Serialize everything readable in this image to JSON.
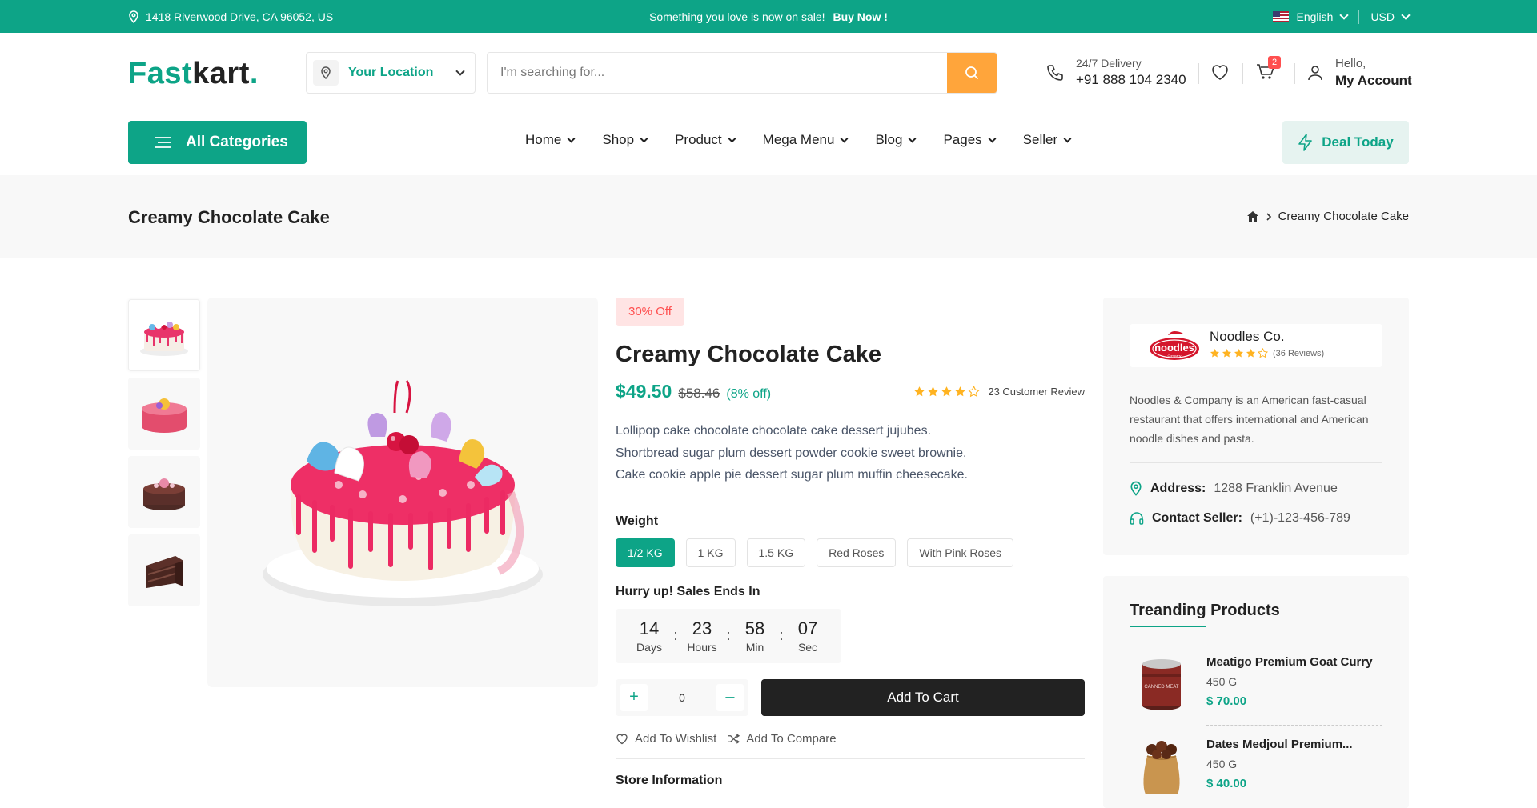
{
  "topbar": {
    "address": "1418 Riverwood Drive, CA 96052, US",
    "promo_text": "Something you love is now on sale!",
    "promo_link": "Buy Now !",
    "language": "English",
    "currency": "USD"
  },
  "header": {
    "logo_part1": "Fast",
    "logo_part2": "kart",
    "logo_dot": ".",
    "location_label": "Your Location",
    "search_placeholder": "I'm searching for...",
    "delivery_label": "24/7 Delivery",
    "delivery_phone": "+91 888 104 2340",
    "cart_count": "2",
    "account_greeting": "Hello,",
    "account_label": "My Account"
  },
  "nav": {
    "all_categories": "All Categories",
    "items": [
      "Home",
      "Shop",
      "Product",
      "Mega Menu",
      "Blog",
      "Pages",
      "Seller"
    ],
    "deal_today": "Deal Today"
  },
  "breadcrumb": {
    "page_title": "Creamy Chocolate Cake",
    "current": "Creamy Chocolate Cake"
  },
  "product": {
    "discount_badge": "30% Off",
    "title": "Creamy Chocolate Cake",
    "price": "$49.50",
    "old_price": "$58.46",
    "off_text": "(8% off)",
    "rating": 4,
    "review_text": "23 Customer Review",
    "description_lines": [
      "Lollipop cake chocolate chocolate cake dessert jujubes.",
      "Shortbread sugar plum dessert powder cookie sweet brownie.",
      "Cake cookie apple pie dessert sugar plum muffin cheesecake."
    ],
    "weight_label": "Weight",
    "weights": [
      "1/2 KG",
      "1 KG",
      "1.5 KG",
      "Red Roses",
      "With Pink Roses"
    ],
    "selected_weight": "1/2 KG",
    "sale_label": "Hurry up! Sales Ends In",
    "timer": [
      {
        "value": "14",
        "unit": "Days"
      },
      {
        "value": "23",
        "unit": "Hours"
      },
      {
        "value": "58",
        "unit": "Min"
      },
      {
        "value": "07",
        "unit": "Sec"
      }
    ],
    "quantity": "0",
    "add_to_cart": "Add To Cart",
    "add_to_wishlist": "Add To Wishlist",
    "add_to_compare": "Add To Compare",
    "store_info_label": "Store Information"
  },
  "vendor": {
    "logo_text": "noodles",
    "logo_subtext": "Company",
    "name": "Noodles Co.",
    "rating": 4,
    "reviews": "(36 Reviews)",
    "description": "Noodles & Company is an American fast-casual restaurant that offers international and American noodle dishes and pasta.",
    "address_label": "Address:",
    "address_value": "1288 Franklin Avenue",
    "contact_label": "Contact Seller:",
    "contact_value": "(+1)-123-456-789"
  },
  "trending": {
    "title": "Treanding Products",
    "items": [
      {
        "name": "Meatigo Premium Goat Curry",
        "weight": "450 G",
        "price": "$ 70.00",
        "can_label": "CANNED MEAT"
      },
      {
        "name": "Dates Medjoul Premium...",
        "weight": "450 G",
        "price": "$ 40.00"
      }
    ]
  },
  "colors": {
    "brand": "#0da487",
    "search_button": "#ffa53b",
    "discount": "#ff4f4f",
    "star": "#ffb321"
  }
}
